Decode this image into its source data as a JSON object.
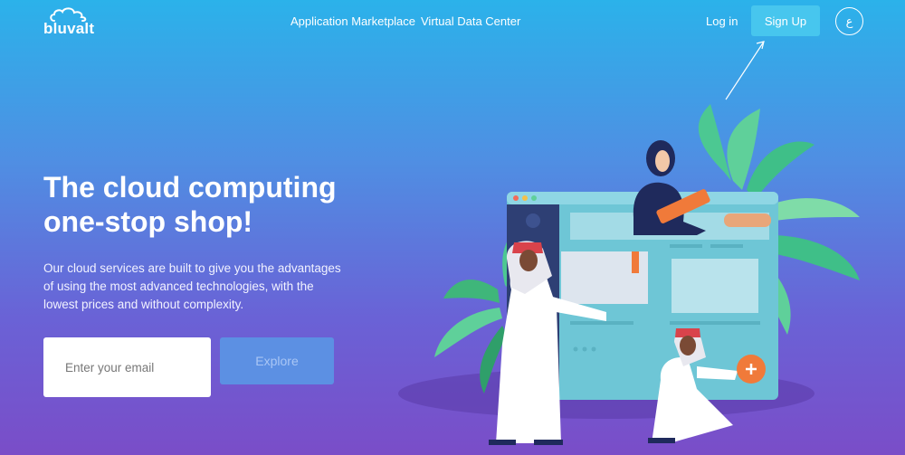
{
  "brand": {
    "name": "bluvalt",
    "logo_icon": "cloud-icon"
  },
  "nav": {
    "links": [
      "Application Marketplace",
      "Virtual Data Center"
    ],
    "login_label": "Log in",
    "signup_label": "Sign Up",
    "language_toggle": "ع"
  },
  "hero": {
    "title_line1": "The cloud computing",
    "title_line2": "one-stop shop!",
    "subtitle": "Our cloud services are built to give you the advantages of using the most advanced technologies, with the lowest prices and without complexity.",
    "email_placeholder": "Enter your email",
    "explore_label": "Explore"
  },
  "colors": {
    "gradient_top": "#2bb2ea",
    "gradient_bottom": "#7a4dc8",
    "signup_bg": "#47c6ee",
    "explore_bg": "#5c90e3"
  }
}
